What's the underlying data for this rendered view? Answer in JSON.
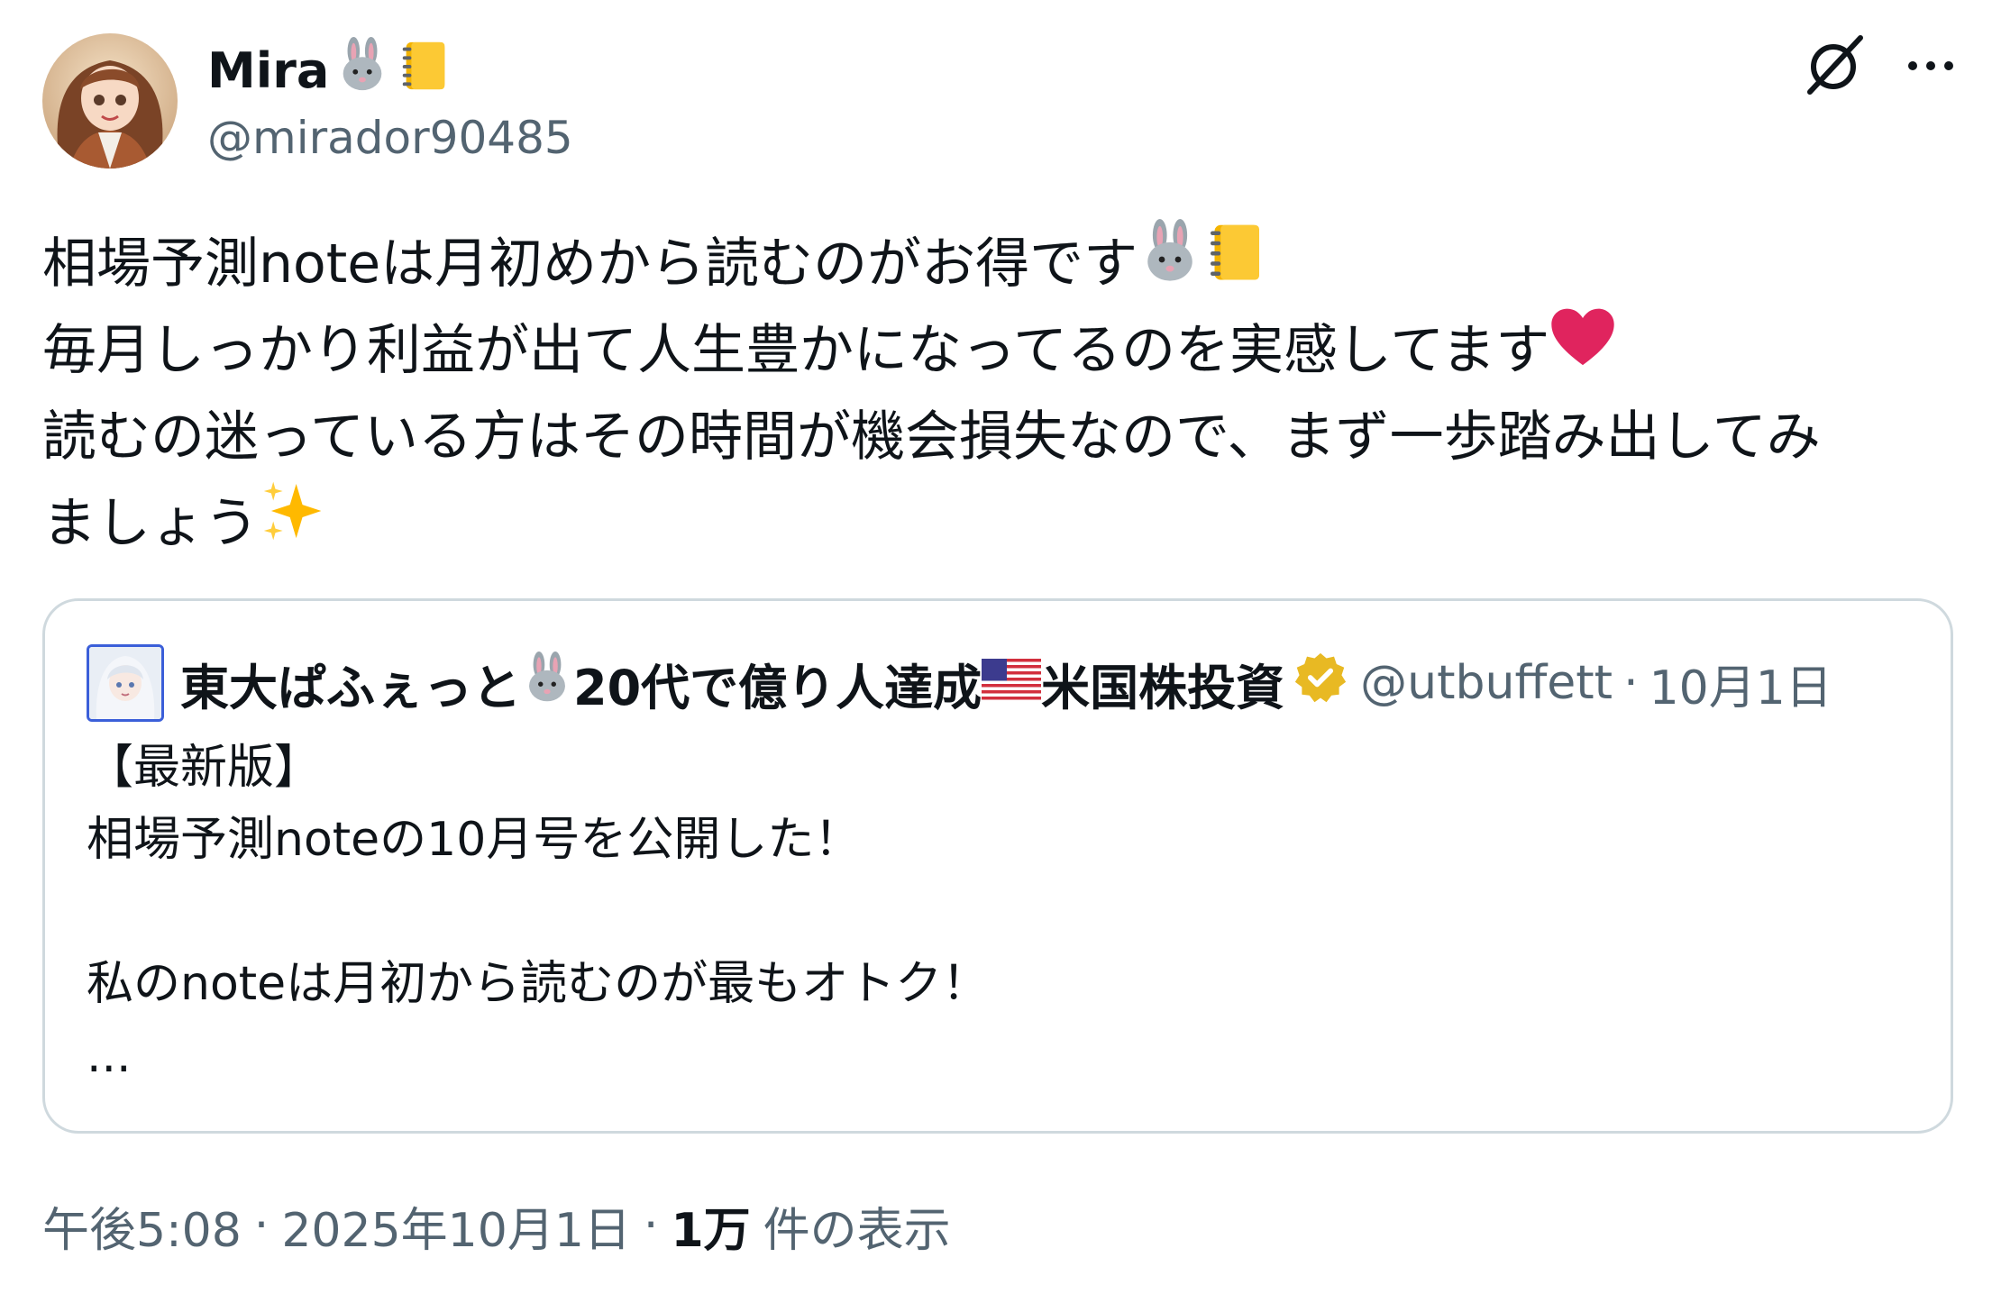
{
  "author": {
    "name": "Mira",
    "handle": "@mirador90485",
    "name_emojis": [
      "rabbit-face-icon",
      "notebook-icon"
    ]
  },
  "tweet": {
    "lines": [
      "相場予測noteは月初めから読むのがお得です",
      "毎月しっかり利益が出て人生豊かになってるのを実感してます",
      "読むの迷っている方はその時間が機会損失なので、まず一歩踏み出してみ",
      "ましょう"
    ]
  },
  "quote": {
    "name_part1": "東大ぱふぇっと",
    "name_part2": "20代で億り人達成",
    "name_part3": "米国株投資",
    "handle": "@utbuffett",
    "separator": "·",
    "date": "10月1日",
    "lines": [
      "【最新版】",
      "相場予測noteの10月号を公開した！",
      "",
      "私のnoteは月初から読むのが最もオトク！",
      "..."
    ]
  },
  "meta": {
    "time": "午後5:08",
    "date": "2025年10月1日",
    "separator": "·",
    "views_count": "1万",
    "views_label": "件の表示"
  },
  "colors": {
    "text": "#0f1419",
    "secondary": "#536471",
    "border": "#cfd9de",
    "verified": "#e8b923",
    "heart": "#e0245e"
  }
}
